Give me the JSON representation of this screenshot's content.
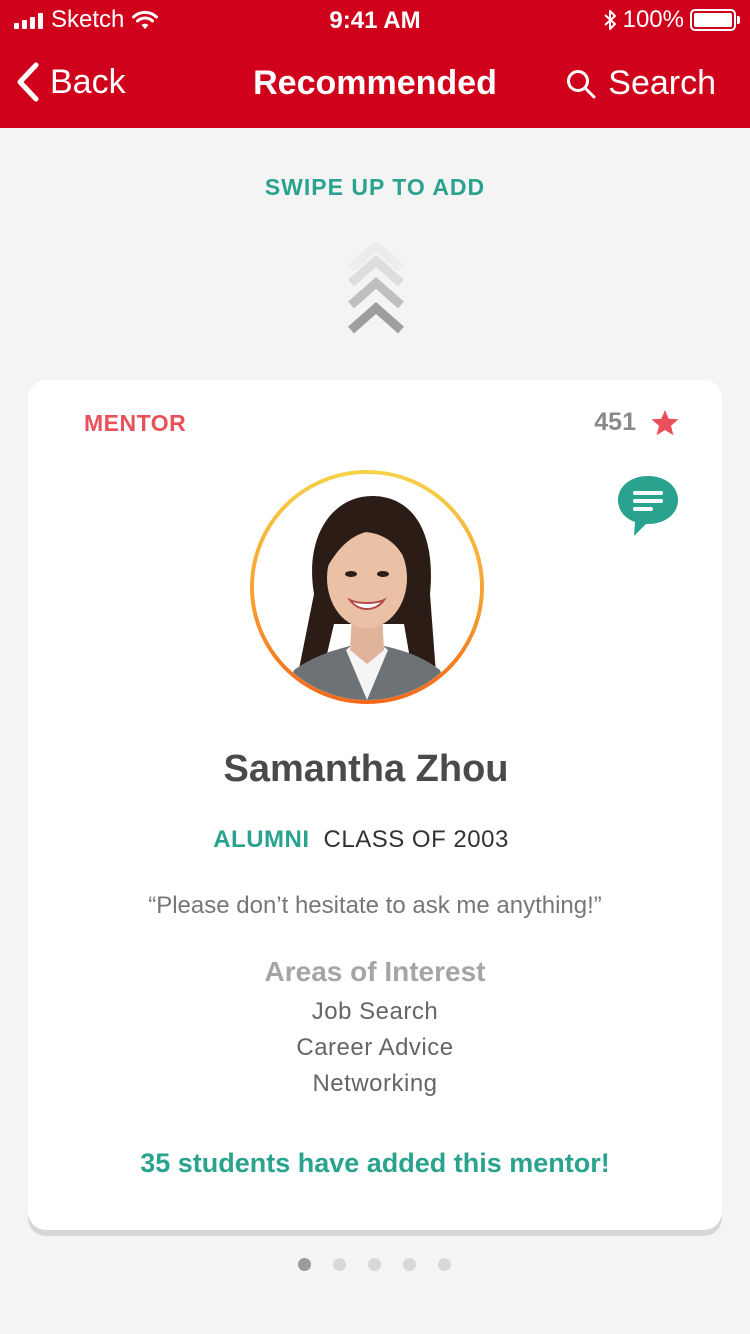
{
  "status_bar": {
    "carrier": "Sketch",
    "time": "9:41 AM",
    "battery": "100%"
  },
  "nav": {
    "back_label": "Back",
    "title": "Recommended",
    "search_label": "Search"
  },
  "swipe_hint": "SWIPE UP TO ADD",
  "card": {
    "type_label": "MENTOR",
    "rating_count": "451",
    "name": "Samantha Zhou",
    "alumni_tag": "ALUMNI",
    "class_of": "CLASS OF 2003",
    "quote": "“Please don’t hesitate to ask me anything!”",
    "interests_title": "Areas of Interest",
    "interests": [
      "Job Search",
      "Career Advice",
      "Networking"
    ],
    "added_text": "35 students have added this mentor!"
  },
  "pagination": {
    "total": 5,
    "active_index": 0
  },
  "colors": {
    "header": "#d0021b",
    "accent_teal": "#2aa38e",
    "accent_pink": "#e8505b"
  },
  "icons": {
    "back": "chevron-left-icon",
    "search": "search-icon",
    "chat": "chat-bubble-icon",
    "star": "star-icon",
    "swipe": "double-chevron-up-icon"
  }
}
